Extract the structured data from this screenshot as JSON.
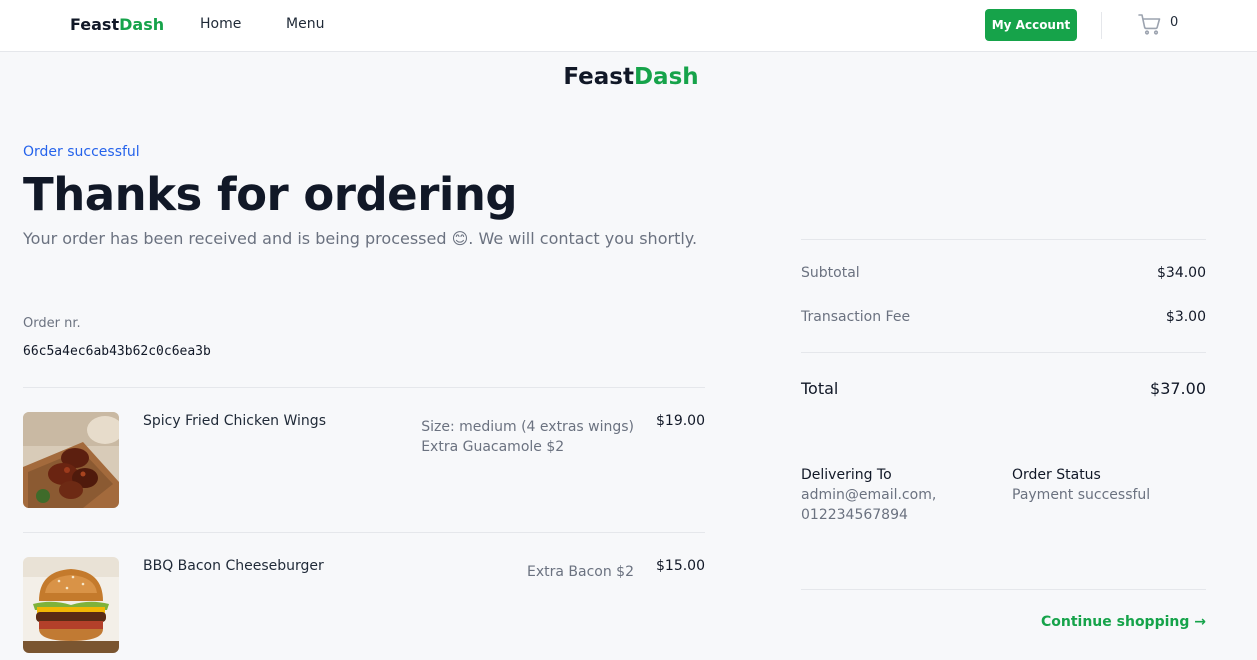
{
  "nav": {
    "brand_part1": "Feast",
    "brand_part2": "Dash",
    "home_label": "Home",
    "menu_label": "Menu",
    "account_label": "My Account",
    "cart_count": "0"
  },
  "hero": {
    "brand_part1": "Feast",
    "brand_part2": "Dash",
    "status_label": "Order successful",
    "title": "Thanks for ordering",
    "subtitle_before": "Your order has been received and is being processed ",
    "subtitle_emoji": "😊",
    "subtitle_after": ". We will contact you shortly."
  },
  "order": {
    "label": "Order nr.",
    "id": "66c5a4ec6ab43b62c0c6ea3b"
  },
  "items": [
    {
      "name": "Spicy Fried Chicken Wings",
      "options": [
        "Size: medium (4 extras wings)",
        "Extra Guacamole $2"
      ],
      "price": "$19.00",
      "image": "chicken-wings-photo"
    },
    {
      "name": "BBQ Bacon Cheeseburger",
      "options": [
        "Extra Bacon $2"
      ],
      "price": "$15.00",
      "image": "cheeseburger-photo"
    }
  ],
  "summary": {
    "subtotal_label": "Subtotal",
    "subtotal_value": "$34.00",
    "fee_label": "Transaction Fee",
    "fee_value": "$3.00",
    "total_label": "Total",
    "total_value": "$37.00"
  },
  "delivery": {
    "title": "Delivering To",
    "email": "admin@email.com,",
    "phone": "012234567894"
  },
  "status": {
    "title": "Order Status",
    "value": "Payment successful"
  },
  "continue_label": "Continue shopping →",
  "colors": {
    "brand_green": "#16a34a",
    "link_blue": "#2563eb",
    "page_bg": "#f7f8fa"
  }
}
